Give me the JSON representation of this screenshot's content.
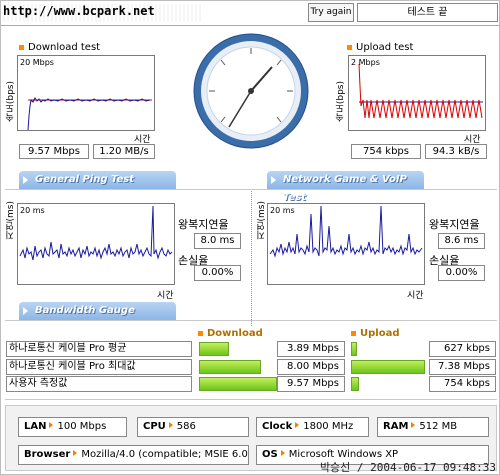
{
  "header": {
    "url": "http://www.bcpark.net",
    "try_again": "Try again",
    "test_end": "테스트 끝"
  },
  "download": {
    "title": "Download test",
    "y_label": "속도(bps)",
    "scale": "20 Mbps",
    "x_label": "시간",
    "speed_bits": "9.57 Mbps",
    "speed_bytes": "1.20 MB/s"
  },
  "upload": {
    "title": "Upload test",
    "y_label": "속도(bps)",
    "scale": "2 Mbps",
    "x_label": "시간",
    "speed_bits": "754 kbps",
    "speed_bytes": "94.3 kB/s"
  },
  "tabs": {
    "ping": "General Ping Test",
    "game": "Network Game & VoIP Test",
    "gauge": "Bandwidth Gauge"
  },
  "ping": {
    "y_label": "지연(ms)",
    "scale": "20 ms",
    "x_label": "시간",
    "rtt_label": "왕복지연율",
    "rtt_value": "8.0 ms",
    "loss_label": "손실율",
    "loss_value": "0.00%"
  },
  "game": {
    "y_label": "지연(ms)",
    "scale": "20 ms",
    "x_label": "시간",
    "rtt_label": "왕복지연율",
    "rtt_value": "8.6 ms",
    "loss_label": "손실율",
    "loss_value": "0.00%"
  },
  "gauge": {
    "download_label": "Download",
    "upload_label": "Upload",
    "rows": [
      {
        "name": "하나로통신 케이블 Pro 평균",
        "down": "3.89 Mbps",
        "down_frac": 0.39,
        "up": "627 kbps",
        "up_frac": 0.08
      },
      {
        "name": "하나로통신 케이블 Pro 최대값",
        "down": "8.00 Mbps",
        "down_frac": 0.8,
        "up": "7.38 Mbps",
        "up_frac": 0.95
      },
      {
        "name": "사용자 측정값",
        "down": "9.57 Mbps",
        "down_frac": 1.0,
        "up": "754 kbps",
        "up_frac": 0.1
      }
    ]
  },
  "specs": {
    "lan_label": "LAN",
    "lan_value": "100 Mbps",
    "cpu_label": "CPU",
    "cpu_value": "586",
    "clock_label": "Clock",
    "clock_value": "1800 MHz",
    "ram_label": "RAM",
    "ram_value": "512 MB",
    "browser_label": "Browser",
    "browser_value": "Mozilla/4.0 (compatible; MSIE 6.0",
    "os_label": "OS",
    "os_value": "Microsoft Windows XP"
  },
  "footer": "박승선 / 2004-06-17 09:48:33",
  "colors": {
    "orange": "#ff8a00",
    "tab_blue": "#8cb6e6",
    "bar_green": "#6cc61a",
    "gauge_blue": "#3b6dab"
  }
}
